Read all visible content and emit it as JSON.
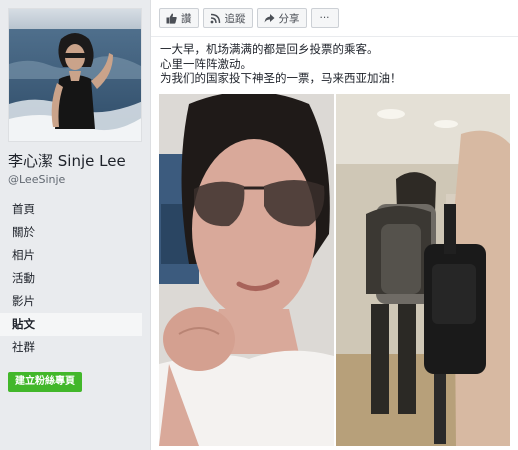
{
  "page": {
    "name": "李心潔 Sinje Lee",
    "handle": "@LeeSinje"
  },
  "nav": {
    "items": [
      {
        "label": "首頁"
      },
      {
        "label": "關於"
      },
      {
        "label": "相片"
      },
      {
        "label": "活動"
      },
      {
        "label": "影片"
      },
      {
        "label": "貼文",
        "active": true
      },
      {
        "label": "社群"
      }
    ],
    "create_page_label": "建立粉絲專頁"
  },
  "actions": {
    "like": {
      "label": "讚",
      "icon": "thumbs-up-icon"
    },
    "follow": {
      "label": "追蹤",
      "icon": "rss-icon"
    },
    "share": {
      "label": "分享",
      "icon": "share-arrow-icon"
    },
    "more": {
      "label": "···"
    }
  },
  "post": {
    "lines": [
      "一大早，机场满满的都是回乡投票的乘客。",
      "心里一阵阵激动。",
      "为我们的国家投下神圣的一票，马来西亚加油！"
    ]
  },
  "colors": {
    "background": "#e9ebee",
    "create_button": "#42b72a",
    "text": "#1d2129",
    "secondary_text": "#606770"
  }
}
